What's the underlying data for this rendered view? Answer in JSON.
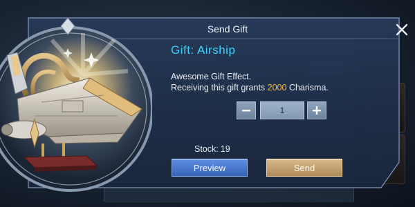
{
  "dialog": {
    "title": "Send Gift",
    "gift_label": "Gift: Airship",
    "description_line1": "Awesome Gift Effect.",
    "description_line2_prefix": "Receiving this gift grants ",
    "charisma_value": "2000",
    "description_line2_suffix": " Charisma.",
    "quantity": "1",
    "stock_label": "Stock:",
    "stock_value": "19",
    "preview_label": "Preview",
    "send_label": "Send"
  },
  "icons": {
    "close": "close-icon",
    "minus": "minus-icon",
    "plus": "plus-icon",
    "gift_image": "airship-gift-icon"
  },
  "colors": {
    "gift_name": "#3fd2ff",
    "highlight": "#f3b84c",
    "preview_button": "#3563b8",
    "send_button": "#b08b58"
  }
}
